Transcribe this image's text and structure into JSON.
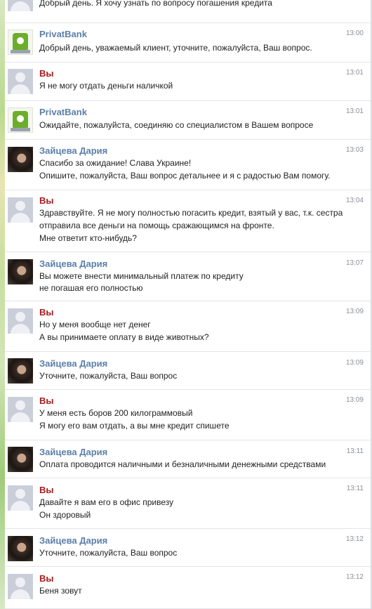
{
  "messages": [
    {
      "author": "",
      "kind": "you",
      "time": "",
      "lines": [
        "Добрый день. Я хочу узнать по вопросу погашения кредита"
      ]
    },
    {
      "author": "PrivatBank",
      "kind": "bank",
      "time": "13:00",
      "lines": [
        "Добрый день, уважаемый клиент, уточните, пожалуйста, Ваш вопрос."
      ]
    },
    {
      "author": "Вы",
      "kind": "you",
      "time": "13:01",
      "lines": [
        "Я не могу отдать деньги наличкой"
      ]
    },
    {
      "author": "PrivatBank",
      "kind": "bank",
      "time": "13:01",
      "lines": [
        "Ожидайте, пожалуйста, соединяю со специалистом в Вашем вопросе"
      ]
    },
    {
      "author": "Зайцева Дария",
      "kind": "agent",
      "time": "13:03",
      "lines": [
        "Спасибо за ожидание! Слава Украине!",
        "Опишите, пожалуйста, Ваш вопрос детальнее и я с радостью Вам помогу."
      ]
    },
    {
      "author": "Вы",
      "kind": "you",
      "time": "13:04",
      "lines": [
        "Здравствуйте. Я не могу полностью погасить кредит, взятый у вас, т.к. сестра",
        "отправила все деньги на помощь сражающимся на фронте.",
        "Мне ответит кто-нибудь?"
      ]
    },
    {
      "author": "Зайцева Дария",
      "kind": "agent",
      "time": "13:07",
      "lines": [
        "Вы можете внести минимальный платеж по кредиту",
        "не погашая его полностью"
      ]
    },
    {
      "author": "Вы",
      "kind": "you",
      "time": "13:09",
      "lines": [
        "Но у меня вообще нет денег",
        "А вы принимаете оплату в виде животных?"
      ]
    },
    {
      "author": "Зайцева Дария",
      "kind": "agent",
      "time": "13:09",
      "lines": [
        "Уточните, пожалуйста, Ваш вопрос"
      ]
    },
    {
      "author": "Вы",
      "kind": "you",
      "time": "13:09",
      "lines": [
        "У меня есть боров 200 килограммовый",
        "Я могу его вам отдать, а вы мне кредит спишете"
      ]
    },
    {
      "author": "Зайцева Дария",
      "kind": "agent",
      "time": "13:11",
      "lines": [
        "Оплата проводится наличными и безналичными денежными средствами"
      ]
    },
    {
      "author": "Вы",
      "kind": "you",
      "time": "13:11",
      "lines": [
        "Давайте я вам его в офис привезу",
        "Он здоровый"
      ]
    },
    {
      "author": "Зайцева Дария",
      "kind": "agent",
      "time": "13:12",
      "lines": [
        "Уточните, пожалуйста, Ваш вопрос"
      ]
    },
    {
      "author": "Вы",
      "kind": "you",
      "time": "13:12",
      "lines": [
        "Беня зовут"
      ]
    }
  ]
}
